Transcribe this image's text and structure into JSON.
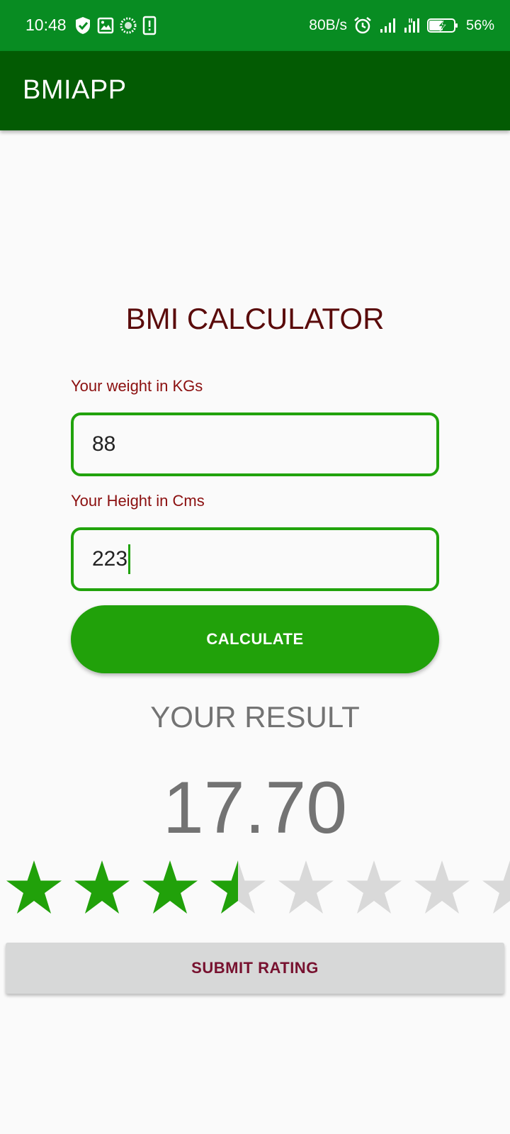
{
  "status_bar": {
    "time": "10:48",
    "network_speed": "80B/s",
    "battery_percent": "56%",
    "left_icons": [
      "shield-check-icon",
      "image-icon",
      "loading-circle-icon",
      "phone-alert-icon"
    ],
    "right_icons": [
      "alarm-clock-icon",
      "signal-bars-icon",
      "signal-bars-icon",
      "battery-charging-icon"
    ],
    "battery_level": 0.56
  },
  "app_bar": {
    "title": "BMIAPP"
  },
  "form": {
    "heading": "BMI CALCULATOR",
    "weight_label": "Your weight in KGs",
    "weight_value": "88",
    "height_label": "Your Height in Cms",
    "height_value": "223",
    "calculate_label": "CALCULATE"
  },
  "result": {
    "heading": "YOUR RESULT",
    "value": "17.70"
  },
  "rating": {
    "value": 3.5,
    "stars_visible": 8,
    "filled_color": "#21a10a",
    "empty_color": "#d9d9d9"
  },
  "submit": {
    "label": "SUBMIT RATING"
  },
  "colors": {
    "status_bar": "#088c22",
    "app_bar": "#035b03",
    "accent_green": "#21a10a",
    "label_red": "#8b0f0f"
  }
}
